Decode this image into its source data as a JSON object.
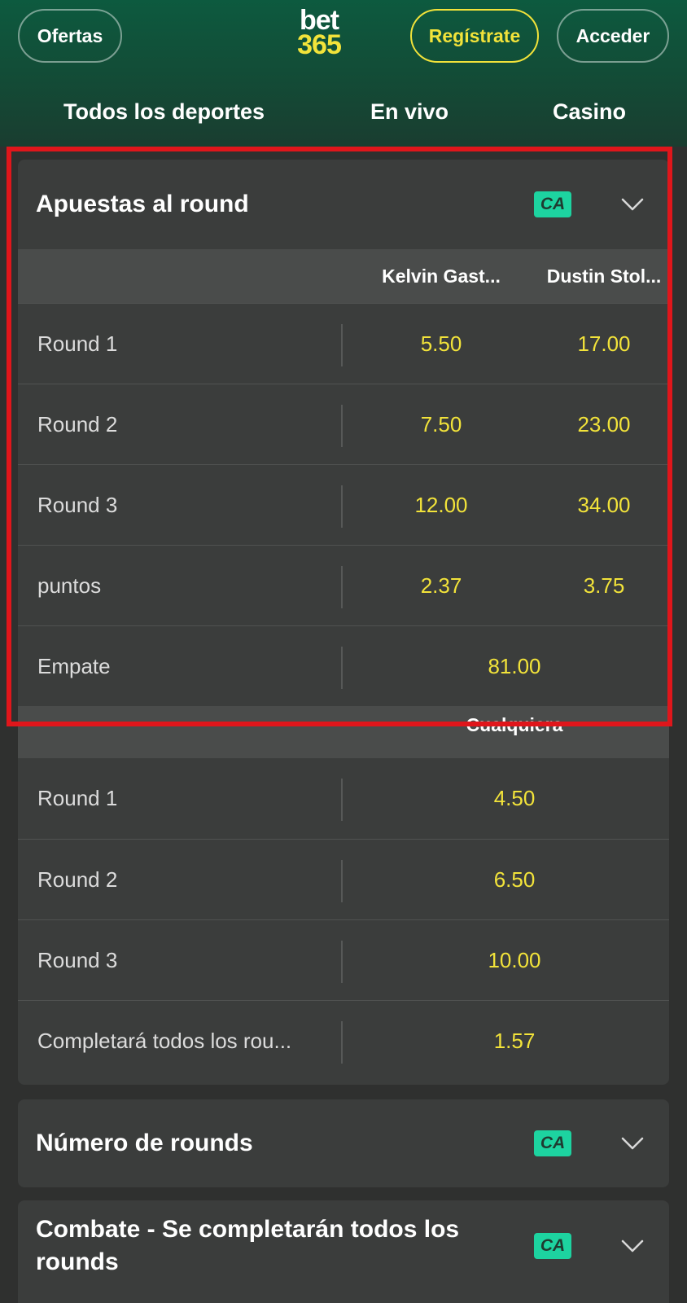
{
  "header": {
    "logo_top": "bet",
    "logo_bottom": "365",
    "offers_label": "Ofertas",
    "register_label": "Regístrate",
    "login_label": "Acceder",
    "nav": [
      "Todos los deportes",
      "En vivo",
      "Casino"
    ]
  },
  "colors": {
    "accent_yellow": "#f2e33a",
    "badge_green": "#1dd3a0",
    "highlight_red": "#e0161b",
    "header_green": "#0d5a3f"
  },
  "round_bets": {
    "title": "Apuestas al round",
    "badge": "CA",
    "columns": [
      "Kelvin Gast...",
      "Dustin Stol..."
    ],
    "rows": [
      {
        "label": "Round 1",
        "odds": [
          "5.50",
          "17.00"
        ]
      },
      {
        "label": "Round 2",
        "odds": [
          "7.50",
          "23.00"
        ]
      },
      {
        "label": "Round 3",
        "odds": [
          "12.00",
          "34.00"
        ]
      },
      {
        "label": "puntos",
        "odds": [
          "2.37",
          "3.75"
        ]
      },
      {
        "label": "Empate",
        "odd": "81.00"
      }
    ],
    "any_column": "Cualquiera",
    "any_rows": [
      {
        "label": "Round 1",
        "odd": "4.50"
      },
      {
        "label": "Round 2",
        "odd": "6.50"
      },
      {
        "label": "Round 3",
        "odd": "10.00"
      },
      {
        "label": "Completará todos los rou...",
        "odd": "1.57"
      }
    ]
  },
  "markets": [
    {
      "title": "Número de rounds",
      "badge": "CA"
    },
    {
      "title": "Combate - Se completarán todos los rounds",
      "badge": "CA"
    }
  ]
}
